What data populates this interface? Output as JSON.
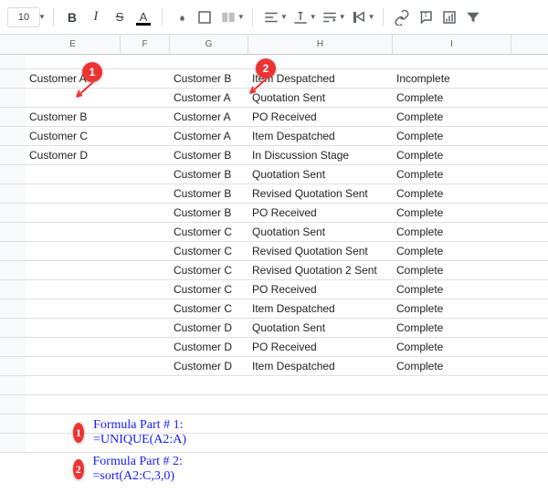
{
  "toolbar": {
    "fontsize": "10",
    "bold": "B",
    "italic": "I",
    "strike": "S",
    "textcolor": "A"
  },
  "columns": [
    "E",
    "F",
    "G",
    "H",
    "I"
  ],
  "rows": [
    {
      "E": "Customer A",
      "F": "",
      "G": "Customer B",
      "H": "Item Despatched",
      "I": "Incomplete"
    },
    {
      "E": "",
      "F": "",
      "G": "Customer A",
      "H": "Quotation Sent",
      "I": "Complete"
    },
    {
      "E": "Customer B",
      "F": "",
      "G": "Customer A",
      "H": "PO Received",
      "I": "Complete"
    },
    {
      "E": "Customer C",
      "F": "",
      "G": "Customer A",
      "H": "Item Despatched",
      "I": "Complete"
    },
    {
      "E": "Customer D",
      "F": "",
      "G": "Customer B",
      "H": "In Discussion Stage",
      "I": "Complete"
    },
    {
      "E": "",
      "F": "",
      "G": "Customer B",
      "H": "Quotation Sent",
      "I": "Complete"
    },
    {
      "E": "",
      "F": "",
      "G": "Customer B",
      "H": "Revised Quotation Sent",
      "I": "Complete"
    },
    {
      "E": "",
      "F": "",
      "G": "Customer B",
      "H": "PO Received",
      "I": "Complete"
    },
    {
      "E": "",
      "F": "",
      "G": "Customer C",
      "H": "Quotation Sent",
      "I": "Complete"
    },
    {
      "E": "",
      "F": "",
      "G": "Customer C",
      "H": "Revised Quotation Sent",
      "I": "Complete"
    },
    {
      "E": "",
      "F": "",
      "G": "Customer C",
      "H": "Revised Quotation 2 Sent",
      "I": "Complete"
    },
    {
      "E": "",
      "F": "",
      "G": "Customer C",
      "H": "PO Received",
      "I": "Complete"
    },
    {
      "E": "",
      "F": "",
      "G": "Customer C",
      "H": "Item Despatched",
      "I": "Complete"
    },
    {
      "E": "",
      "F": "",
      "G": "Customer D",
      "H": "Quotation Sent",
      "I": "Complete"
    },
    {
      "E": "",
      "F": "",
      "G": "Customer D",
      "H": "PO Received",
      "I": "Complete"
    },
    {
      "E": "",
      "F": "",
      "G": "Customer D",
      "H": "Item Despatched",
      "I": "Complete"
    }
  ],
  "annotations": {
    "badge1": "1",
    "badge2": "2",
    "formula1": "Formula Part # 1: =UNIQUE(A2:A)",
    "formula2": "Formula Part # 2: =sort(A2:C,3,0)"
  }
}
